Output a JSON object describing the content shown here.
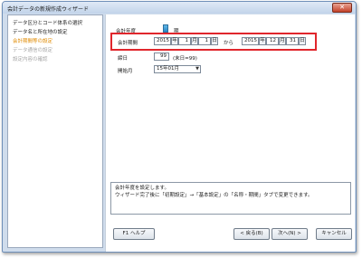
{
  "window": {
    "title": "会計データの新規作成ウィザード",
    "close": "✕"
  },
  "sidebar": {
    "items": [
      {
        "label": "データ区分とコード体系の選択",
        "state": "normal"
      },
      {
        "label": "データ名と所在地の設定",
        "state": "normal"
      },
      {
        "label": "会計期間等の設定",
        "state": "active"
      },
      {
        "label": "データ通信の設定",
        "state": "dim"
      },
      {
        "label": "設定内容の確認",
        "state": "dim"
      }
    ]
  },
  "form": {
    "fiscal_year_label": "会計年度",
    "fiscal_year_value": "期",
    "period_label": "会計期間",
    "start_year": "2015",
    "start_month": "1",
    "start_day": "1",
    "unit_year": "年",
    "unit_month": "月",
    "unit_day": "日",
    "from_label": "から",
    "end_year": "2015",
    "end_month": "12",
    "end_day": "31",
    "decision_label": "締日",
    "decision_value": "99",
    "decision_note": "(末日=99)",
    "start_month_label": "開始月",
    "start_month_select": "15年01月"
  },
  "message": {
    "line1": "会計年度を設定します。",
    "line2": "ウィザード完了後に「初期設定」→「基本設定」の「名称・期間」タブで変更できます。"
  },
  "buttons": {
    "help": "F1 ヘルプ",
    "back": "< 戻る(B)",
    "next": "次へ(N) >",
    "cancel": "キャンセル"
  }
}
